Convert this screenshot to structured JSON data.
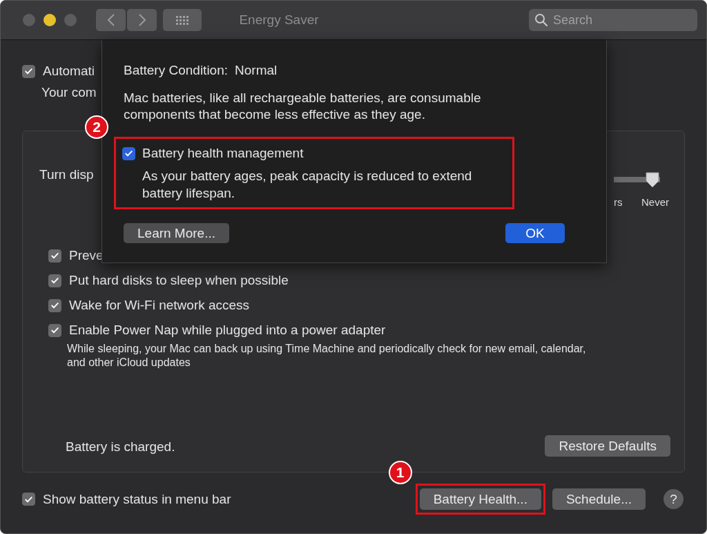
{
  "window": {
    "title": "Energy Saver",
    "search": {
      "placeholder": "Search"
    }
  },
  "top_option": {
    "label": "Automati",
    "checked": true,
    "description": "Your com"
  },
  "panel": {
    "slider": {
      "label": "Turn disp",
      "level": 1,
      "tick_labels": [
        "rs",
        "Never"
      ]
    },
    "options": [
      {
        "label": "Preve",
        "checked": true
      },
      {
        "label": "Put hard disks to sleep when possible",
        "checked": true
      },
      {
        "label": "Wake for Wi-Fi network access",
        "checked": true
      },
      {
        "label": "Enable Power Nap while plugged into a power adapter",
        "checked": true,
        "description": "While sleeping, your Mac can back up using Time Machine and periodically check for new email, calendar, and other iCloud updates"
      }
    ],
    "status": "Battery is charged.",
    "restore_button": "Restore Defaults"
  },
  "bottom": {
    "option": {
      "label": "Show battery status in menu bar",
      "checked": true
    },
    "buttons": [
      {
        "label": "Battery Health...",
        "highlighted": true,
        "badge": "1"
      },
      {
        "label": "Schedule...",
        "highlighted": false
      }
    ],
    "help": "?"
  },
  "sheet": {
    "condition_label": "Battery Condition:",
    "condition_value": "Normal",
    "intro": "Mac batteries, like all rechargeable batteries, are consumable components that become less effective as they age.",
    "option": {
      "label": "Battery health management",
      "checked": true,
      "description": "As your battery ages, peak capacity is reduced to extend battery lifespan.",
      "highlighted": true,
      "badge": "2"
    },
    "buttons": [
      {
        "label": "Learn More...",
        "default": false
      },
      {
        "label": "OK",
        "default": true
      }
    ]
  }
}
